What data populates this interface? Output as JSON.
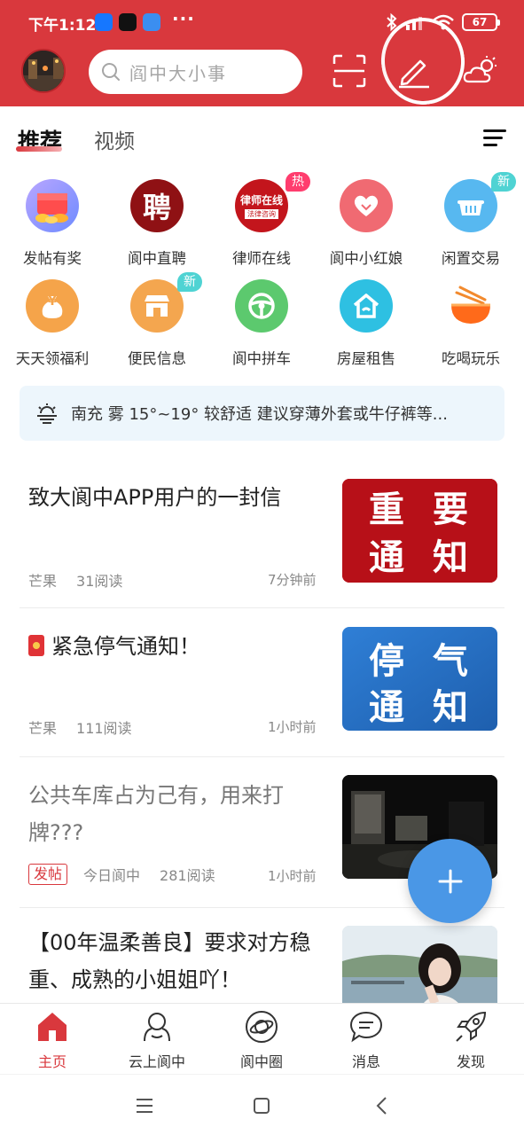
{
  "status_bar": {
    "time": "下午1:12",
    "battery": "67"
  },
  "header": {
    "search_placeholder": "阎中大小事",
    "scan_icon": "scan-icon",
    "edit_icon": "pencil-icon",
    "weather_icon": "cloud-sun-icon"
  },
  "tabs": [
    {
      "label": "推荐",
      "active": true
    },
    {
      "label": "视频",
      "active": false
    }
  ],
  "grid": [
    {
      "label": "发帖有奖",
      "icon": "gift-coins-icon"
    },
    {
      "label": "阆中直聘",
      "icon": "recruit-icon",
      "glyph": "聘"
    },
    {
      "label": "律师在线",
      "icon": "lawyer-icon",
      "badge": "热",
      "line1": "律师在线",
      "line2": "法律咨询"
    },
    {
      "label": "阆中小红娘",
      "icon": "heart-icon"
    },
    {
      "label": "闲置交易",
      "icon": "basket-icon",
      "badge": "新"
    },
    {
      "label": "天天领福利",
      "icon": "money-bag-icon",
      "glyph": "¥"
    },
    {
      "label": "便民信息",
      "icon": "shop-icon",
      "badge": "新"
    },
    {
      "label": "阆中拼车",
      "icon": "steering-wheel-icon"
    },
    {
      "label": "房屋租售",
      "icon": "house-icon"
    },
    {
      "label": "吃喝玩乐",
      "icon": "noodle-bowl-icon"
    }
  ],
  "weather": {
    "text": "南充 雾 15°~19° 较舒适 建议穿薄外套或牛仔裤等..."
  },
  "posts": [
    {
      "title": "致大阆中APP用户的一封信",
      "author": "芒果",
      "reads": "31阅读",
      "time": "7分钟前",
      "thumb": {
        "type": "notice",
        "line1a": "重",
        "line1b": "要",
        "line2a": "通",
        "line2b": "知",
        "color": "#c0141c"
      }
    },
    {
      "title": "紧急停气通知！",
      "author": "芒果",
      "reads": "111阅读",
      "time": "1小时前",
      "thumb": {
        "type": "notice",
        "line1a": "停",
        "line1b": "气",
        "line2a": "通",
        "line2b": "知",
        "color": "#2b73c7"
      }
    },
    {
      "title": "公共车库占为己有，用来打牌???",
      "tag": "发帖",
      "author": "今日阆中",
      "reads": "281阅读",
      "time": "1小时前",
      "thumb": {
        "type": "dark-photo"
      }
    },
    {
      "title": "【00年温柔善良】要求对方稳重、成熟的小姐姐吖！",
      "thumb": {
        "type": "portrait-photo"
      }
    }
  ],
  "bottom_nav": [
    {
      "label": "主页",
      "icon": "home-icon",
      "active": true
    },
    {
      "label": "云上阆中",
      "icon": "cloud-people-icon",
      "active": false
    },
    {
      "label": "阆中圈",
      "icon": "planet-icon",
      "active": false
    },
    {
      "label": "消息",
      "icon": "chat-bubble-icon",
      "active": false
    },
    {
      "label": "发现",
      "icon": "rocket-icon",
      "active": false
    }
  ],
  "colors": {
    "brand": "#d9383d",
    "fab": "#4a97e6"
  }
}
